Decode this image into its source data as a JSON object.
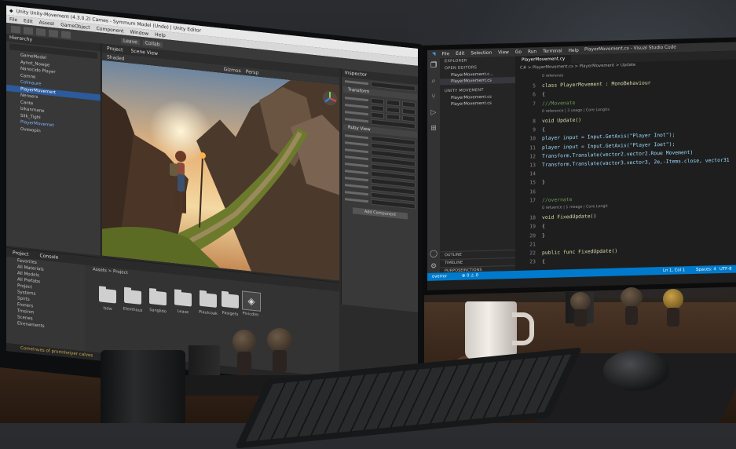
{
  "unity": {
    "window_title": "Unity  Unity-Movement (4.3.0.2) Cames - Symmum Model (Undo) | Unity Editor",
    "menu": [
      "File",
      "Edit",
      "Assest",
      "GameObject",
      "Component",
      "Window",
      "Help"
    ],
    "toolbar_buttons": [
      "Leave",
      "Collab"
    ],
    "hierarchy_tab": "Hierarchy",
    "hierarchy_items": [
      "GameModel",
      "Aynot_Nowge",
      "Nanocido Player",
      "Camne",
      "Colmaure",
      "PlayerMovemert",
      "Nensers",
      "Cante",
      "bikanmane",
      "Slik_Tighl",
      "PlayerMovemet",
      "Ovesopin"
    ],
    "scene_tabs": [
      "Project",
      "Scene View"
    ],
    "scene_shaded": "Shaded",
    "scene_toolbar": [
      "Gizmos",
      "Persp"
    ],
    "project_tabs": [
      "Project",
      "Console"
    ],
    "project_tree": [
      "Favorites",
      "All Materials",
      "All Models",
      "All Prefabs",
      "Project",
      "Systems",
      "Spirts",
      "Froners",
      "Trnsinm",
      "Scenes",
      "Elrenaments"
    ],
    "breadcrumb": "Assets > Project",
    "folders": [
      "Isdw",
      "Elenthaus",
      "Sanglido",
      "Lease",
      "Piaulcoak",
      "Pasigets",
      "Pivicdim"
    ],
    "inspector_labels": [
      "Inspector",
      "Transform",
      "Ruby View",
      "Add Component"
    ],
    "status_text": "Comeinues of prorinheiyer calves"
  },
  "vscode": {
    "window_title": "PlayerMovement.cs - Visual Studio Code",
    "menu": [
      "File",
      "Edit",
      "Selection",
      "View",
      "Go",
      "Run",
      "Terminal",
      "Help"
    ],
    "explorer_header": "EXPLORER",
    "open_editors_header": "OPEN EDITORS",
    "open_editors": [
      "PlayerMovement.c...",
      "PlayerMovement.cs"
    ],
    "project_header": "UNITY MOVEMENT",
    "project_files": [
      "PlayerMovement.cs",
      "PlayerMovement.cs"
    ],
    "bottom_sections": [
      "OUTLINE",
      "TIMELINE",
      "PURPOSEINCTIONS"
    ],
    "tab_label": "PlayerMovement.cy",
    "breadcrumb": "C# > PlayerMovement.cs > PlayerMovement > Update",
    "code_lines": [
      {
        "n": "",
        "hint": "0 referenas"
      },
      {
        "n": "5",
        "text": "class PlayerMovement : MonoBehaviour"
      },
      {
        "n": "6",
        "text": "{"
      },
      {
        "n": "7",
        "text": "    ///Movenate"
      },
      {
        "n": "",
        "hint": "0 reference | 3 usage | Core Longits"
      },
      {
        "n": "8",
        "text": "    void Update()"
      },
      {
        "n": "9",
        "text": "    {"
      },
      {
        "n": "10",
        "text": "        player input = Input.GetAxis(\"Player Inot\");"
      },
      {
        "n": "11",
        "text": "        player input = Input.GetAxis(\"Player Ioet\");"
      },
      {
        "n": "12",
        "text": "        Transform.Translate(vector2.vector2.Roue Movement)"
      },
      {
        "n": "13",
        "text": "        Transform.Translate(vactor3.vector3, 2e,-Items.close, vector31"
      },
      {
        "n": "14",
        "text": ""
      },
      {
        "n": "15",
        "text": "    }"
      },
      {
        "n": "16",
        "text": ""
      },
      {
        "n": "17",
        "text": "    //overnate"
      },
      {
        "n": "",
        "hint": "0 refuence | 1 meage | Core Longit"
      },
      {
        "n": "18",
        "text": "    void FixedUpdate()"
      },
      {
        "n": "19",
        "text": "    {"
      },
      {
        "n": "20",
        "text": "    }"
      },
      {
        "n": "21",
        "text": ""
      },
      {
        "n": "22",
        "text": "    public func FixedUpdate()"
      },
      {
        "n": "23",
        "text": "    {"
      }
    ],
    "status_left": "overror",
    "status_counts": "⊗ 0 ⚠ 0",
    "status_position": "Ln 1, Col 1",
    "status_spaces": "Spaces: 4",
    "status_encoding": "UTF-8"
  },
  "colors": {
    "unity_bg": "#2b2b2b",
    "unity_selection": "#2d5a9b",
    "vscode_bg": "#1e1e1e",
    "vscode_status": "#007acc",
    "play_active": "#2f6bc2"
  }
}
